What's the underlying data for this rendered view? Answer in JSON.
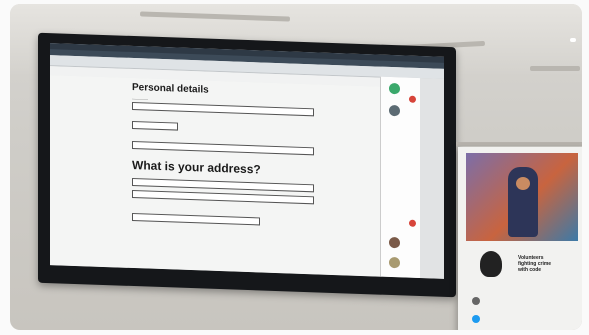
{
  "screen": {
    "page": {
      "heading_personal": "Personal details",
      "heading_address": "What is your address?"
    }
  },
  "poster": {
    "tagline": [
      "Volunteers",
      "fighting crime",
      "with code"
    ]
  },
  "colors": {
    "tv_bezel": "#15171a",
    "browser_chrome": "#3c4a58",
    "page_background": "#f4f5f4",
    "sidebar_red_badge": "#d7443a",
    "avatar_green": "#3aa86b"
  }
}
